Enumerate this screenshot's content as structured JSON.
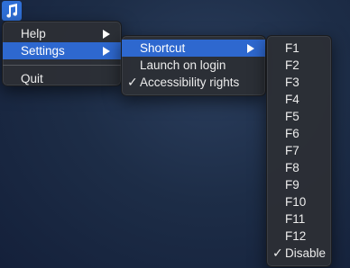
{
  "app": {
    "icon": "music-note-icon",
    "accent_color": "#2f6fd6"
  },
  "main_menu": {
    "items": [
      {
        "label": "Help",
        "submenu": true
      },
      {
        "label": "Settings",
        "submenu": true,
        "highlighted": true
      },
      {
        "label": "Quit"
      }
    ]
  },
  "settings_menu": {
    "items": [
      {
        "label": "Shortcut",
        "submenu": true,
        "highlighted": true
      },
      {
        "label": "Launch on login"
      },
      {
        "label": "Accessibility rights",
        "checked": true
      }
    ]
  },
  "shortcut_menu": {
    "items": [
      {
        "label": "F1"
      },
      {
        "label": "F2"
      },
      {
        "label": "F3"
      },
      {
        "label": "F4"
      },
      {
        "label": "F5"
      },
      {
        "label": "F6"
      },
      {
        "label": "F7"
      },
      {
        "label": "F8"
      },
      {
        "label": "F9"
      },
      {
        "label": "F10"
      },
      {
        "label": "F11"
      },
      {
        "label": "F12"
      },
      {
        "label": "Disable",
        "checked": true
      }
    ]
  },
  "symbols": {
    "check": "✓"
  },
  "colors": {
    "highlight": "#2e68cf",
    "menu_bg": "#2c2f35",
    "desktop": "#1d2d47"
  }
}
